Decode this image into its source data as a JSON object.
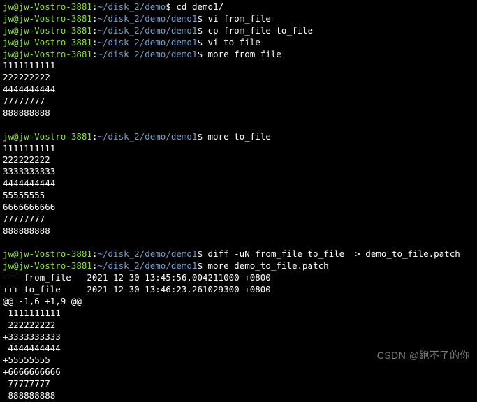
{
  "prompts": {
    "user_host": "jw@jw-Vostro-3881",
    "sep1": ":",
    "path_demo": "~/disk_2/demo",
    "path_demo1": "~/disk_2/demo/demo1",
    "dollar": "$ "
  },
  "commands": {
    "cd": "cd demo1/",
    "vi_from": "vi from_file",
    "cp": "cp from_file to_file",
    "vi_to": "vi to_file",
    "more_from": "more from_file",
    "more_to": "more to_file",
    "diff": "diff -uN from_file to_file  > demo_to_file.patch",
    "more_patch": "more demo_to_file.patch"
  },
  "from_file_content": [
    "1111111111",
    "222222222",
    "4444444444",
    "77777777",
    "888888888"
  ],
  "to_file_content": [
    "1111111111",
    "222222222",
    "3333333333",
    "4444444444",
    "55555555",
    "6666666666",
    "77777777",
    "888888888"
  ],
  "patch_output": [
    "--- from_file   2021-12-30 13:45:56.004211000 +0800",
    "+++ to_file     2021-12-30 13:46:23.261029300 +0800",
    "@@ -1,6 +1,9 @@",
    " 1111111111",
    " 222222222",
    "+3333333333",
    " 4444444444",
    "+55555555",
    "+6666666666",
    " 77777777",
    " 888888888"
  ],
  "watermark": "CSDN @跑不了的你"
}
